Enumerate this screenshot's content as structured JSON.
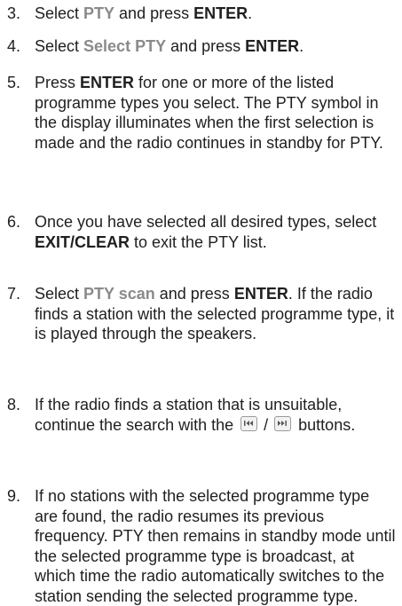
{
  "steps": [
    {
      "number": "3.",
      "parts": [
        {
          "t": "Select "
        },
        {
          "t": "PTY",
          "s": "hl"
        },
        {
          "t": " and press "
        },
        {
          "t": "ENTER",
          "s": "b"
        },
        {
          "t": "."
        }
      ]
    },
    {
      "number": "4.",
      "parts": [
        {
          "t": "Select "
        },
        {
          "t": "Select PTY",
          "s": "hl"
        },
        {
          "t": " and press "
        },
        {
          "t": "ENTER",
          "s": "b"
        },
        {
          "t": "."
        }
      ]
    },
    {
      "number": "5.",
      "parts": [
        {
          "t": "Press "
        },
        {
          "t": "ENTER",
          "s": "b"
        },
        {
          "t": " for one or more of the listed programme types you select. The PTY symbol in the display illuminates when the first selection is made and the radio continues in standby for PTY."
        }
      ]
    },
    {
      "number": "6.",
      "parts": [
        {
          "t": "Once you have selected all desired types, select "
        },
        {
          "t": "EXIT/CLEAR",
          "s": "b"
        },
        {
          "t": " to exit the PTY list."
        }
      ]
    },
    {
      "number": "7.",
      "parts": [
        {
          "t": "Select "
        },
        {
          "t": "PTY scan",
          "s": "hl"
        },
        {
          "t": " and press "
        },
        {
          "t": "ENTER",
          "s": "b"
        },
        {
          "t": ". If the radio finds a station with the selected programme type, it is played through the speakers."
        }
      ]
    },
    {
      "number": "8.",
      "parts": [
        {
          "t": "If the radio finds a station that is unsuitable, continue the search with the "
        },
        {
          "icon": "seek-back-icon"
        },
        {
          "t": "/",
          "s": "sep"
        },
        {
          "icon": "seek-forward-icon"
        },
        {
          "t": " buttons."
        }
      ]
    },
    {
      "number": "9.",
      "parts": [
        {
          "t": "If no stations with the selected programme type are found, the radio resumes its previous frequency. PTY then remains in standby mode until the selected programme type is broadcast, at which time the radio automatically switches to the station sending the selected programme type."
        }
      ]
    }
  ],
  "colors": {
    "text": "#1f1f1f",
    "menu_highlight": "#8a8a8a",
    "icon_border": "#9a9a9a"
  }
}
